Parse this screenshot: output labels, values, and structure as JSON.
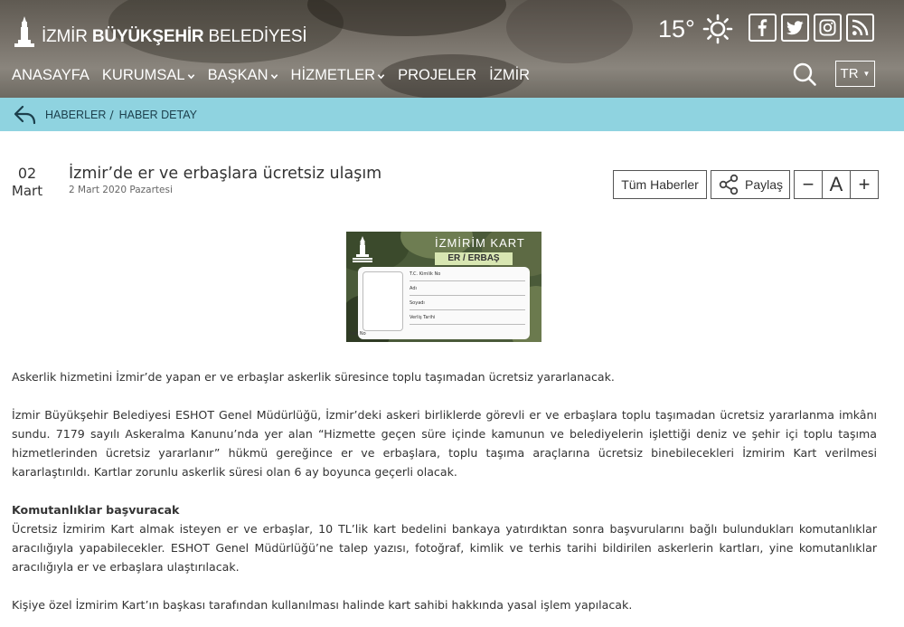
{
  "header": {
    "brand_prefix": "İZMİR",
    "brand_bold": "BÜYÜKŞEHİR",
    "brand_suffix": "BELEDİYESİ",
    "temperature": "15°",
    "weather_icon": "sun-icon",
    "socials": [
      "facebook-icon",
      "twitter-icon",
      "instagram-icon",
      "rss-icon"
    ],
    "nav": [
      {
        "label": "ANASAYFA",
        "dropdown": false
      },
      {
        "label": "KURUMSAL",
        "dropdown": true
      },
      {
        "label": "BAŞKAN",
        "dropdown": true
      },
      {
        "label": "HİZMETLER",
        "dropdown": true
      },
      {
        "label": "PROJELER",
        "dropdown": false
      },
      {
        "label": "İZMİR",
        "dropdown": false
      }
    ],
    "language": "TR"
  },
  "breadcrumb": {
    "items": [
      "HABERLER",
      "HABER DETAY"
    ],
    "separator": "/"
  },
  "article": {
    "day": "02",
    "month": "Mart",
    "title": "İzmir’de er ve erbaşlara ücretsiz ulaşım",
    "date_text": "2 Mart 2020 Pazartesi",
    "buttons": {
      "all_news": "Tüm Haberler",
      "share": "Paylaş",
      "font_decrease": "−",
      "font_reset": "A",
      "font_increase": "+"
    },
    "card": {
      "brand": "İZMİRİM KART",
      "type": "ER / ERBAŞ",
      "fields": [
        "T.C. Kimlik No",
        "Adı",
        "Soyadı",
        "Verliş Tarihi"
      ],
      "card_no_label": "Kart No"
    },
    "paragraphs": {
      "p1": "Askerlik hizmetini İzmir’de yapan er ve erbaşlar askerlik süresince toplu taşımadan ücretsiz yararlanacak.",
      "p2": "İzmir Büyükşehir Belediyesi ESHOT Genel Müdürlüğü, İzmir’deki askeri birliklerde görevli er ve erbaşlara toplu taşımadan ücretsiz yararlanma imkânı sundu. 7179 sayılı Askeralma Kanunu’nda yer alan “Hizmette geçen süre içinde kamunun ve belediyelerin işlettiği deniz ve şehir içi toplu taşıma hizmetlerinden ücretsiz yararlanır” hükmü gereğince er ve erbaşlara, toplu taşıma araçlarına ücretsiz binebilecekleri İzmirim Kart verilmesi kararlaştırıldı. Kartlar zorunlu askerlik süresi olan 6 ay boyunca geçerli olacak.",
      "p3_heading": "Komutanlıklar başvuracak",
      "p3": "Ücretsiz İzmirim Kart almak isteyen er ve erbaşlar, 10 TL’lik kart bedelini bankaya yatırdıktan sonra başvurularını bağlı bulundukları komutanlıklar aracılığıyla yapabilecekler. ESHOT Genel Müdürlüğü’ne talep yazısı, fotoğraf, kimlik ve terhis tarihi bildirilen askerlerin kartları, yine komutanlıklar aracılığıyla er ve erbaşlara ulaştırılacak.",
      "p4": "Kişiye özel İzmirim Kart’ın başkası tarafından kullanılması halinde kart sahibi hakkında yasal işlem yapılacak."
    }
  },
  "colors": {
    "breadcrumb_bar": "#8fd3e0",
    "header_overlay": "#746e66",
    "card_green": "#4a5a39"
  }
}
